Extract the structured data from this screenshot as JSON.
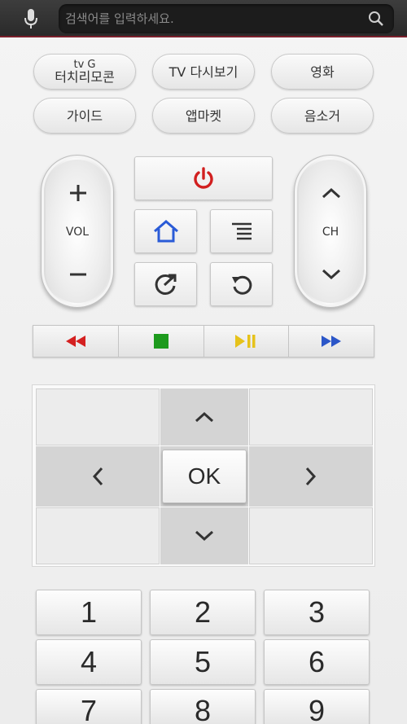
{
  "search": {
    "placeholder": "검색어를 입력하세요."
  },
  "pills": {
    "row1": [
      {
        "line1": "tv G",
        "line2": "터치리모콘"
      },
      {
        "label": "TV 다시보기"
      },
      {
        "label": "영화"
      }
    ],
    "row2": [
      {
        "label": "가이드"
      },
      {
        "label": "앱마켓"
      },
      {
        "label": "음소거"
      }
    ]
  },
  "volume": {
    "label": "VOL"
  },
  "channel": {
    "label": "CH"
  },
  "dpad": {
    "ok_label": "OK"
  },
  "numpad": [
    "1",
    "2",
    "3",
    "4",
    "5",
    "6",
    "7",
    "8",
    "9"
  ],
  "colors": {
    "power": "#d11f1f",
    "home": "#2a5bd7",
    "rewind": "#d42020",
    "stop": "#1d9a1d",
    "play_pause": "#e6c21a",
    "fast_forward": "#2b56c8",
    "accent_line": "#7a1f2b"
  }
}
